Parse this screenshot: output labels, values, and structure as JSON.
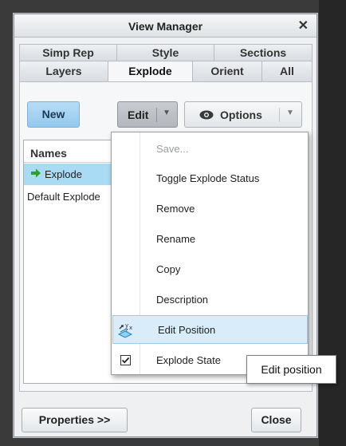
{
  "window": {
    "title": "View Manager",
    "close_glyph": "✕"
  },
  "tabs": {
    "row1": [
      {
        "label": "Simp Rep"
      },
      {
        "label": "Style"
      },
      {
        "label": "Sections"
      }
    ],
    "row2": [
      {
        "label": "Layers"
      },
      {
        "label": "Explode",
        "active": true
      },
      {
        "label": "Orient"
      },
      {
        "label": "All"
      }
    ]
  },
  "toolbar": {
    "new_label": "New",
    "edit_label": "Edit",
    "options_label": "Options",
    "caret": "▼"
  },
  "list": {
    "header": "Names",
    "rows": [
      {
        "label": "Explode",
        "selected": true,
        "icon": "green-arrow-icon"
      },
      {
        "label": "Default Explode",
        "selected": false
      }
    ]
  },
  "edit_menu": {
    "items": [
      {
        "label": "Save...",
        "disabled": true
      },
      {
        "label": "Toggle Explode Status"
      },
      {
        "label": "Remove"
      },
      {
        "label": "Rename"
      },
      {
        "label": "Copy"
      },
      {
        "label": "Description"
      },
      {
        "label": "Edit Position",
        "highlighted": true,
        "icon": "edit-position-icon"
      },
      {
        "label": "Explode State",
        "checked": true,
        "icon": "checkbox-checked-icon"
      }
    ]
  },
  "tooltip": {
    "text": "Edit position"
  },
  "bottom": {
    "properties_label": "Properties >>",
    "close_label": "Close"
  },
  "colors": {
    "new_button": "#94c9ee",
    "selected_row": "#a9dbf5",
    "menu_highlight": "#d8ecfa",
    "arrow_green": "#2e9e2e"
  }
}
